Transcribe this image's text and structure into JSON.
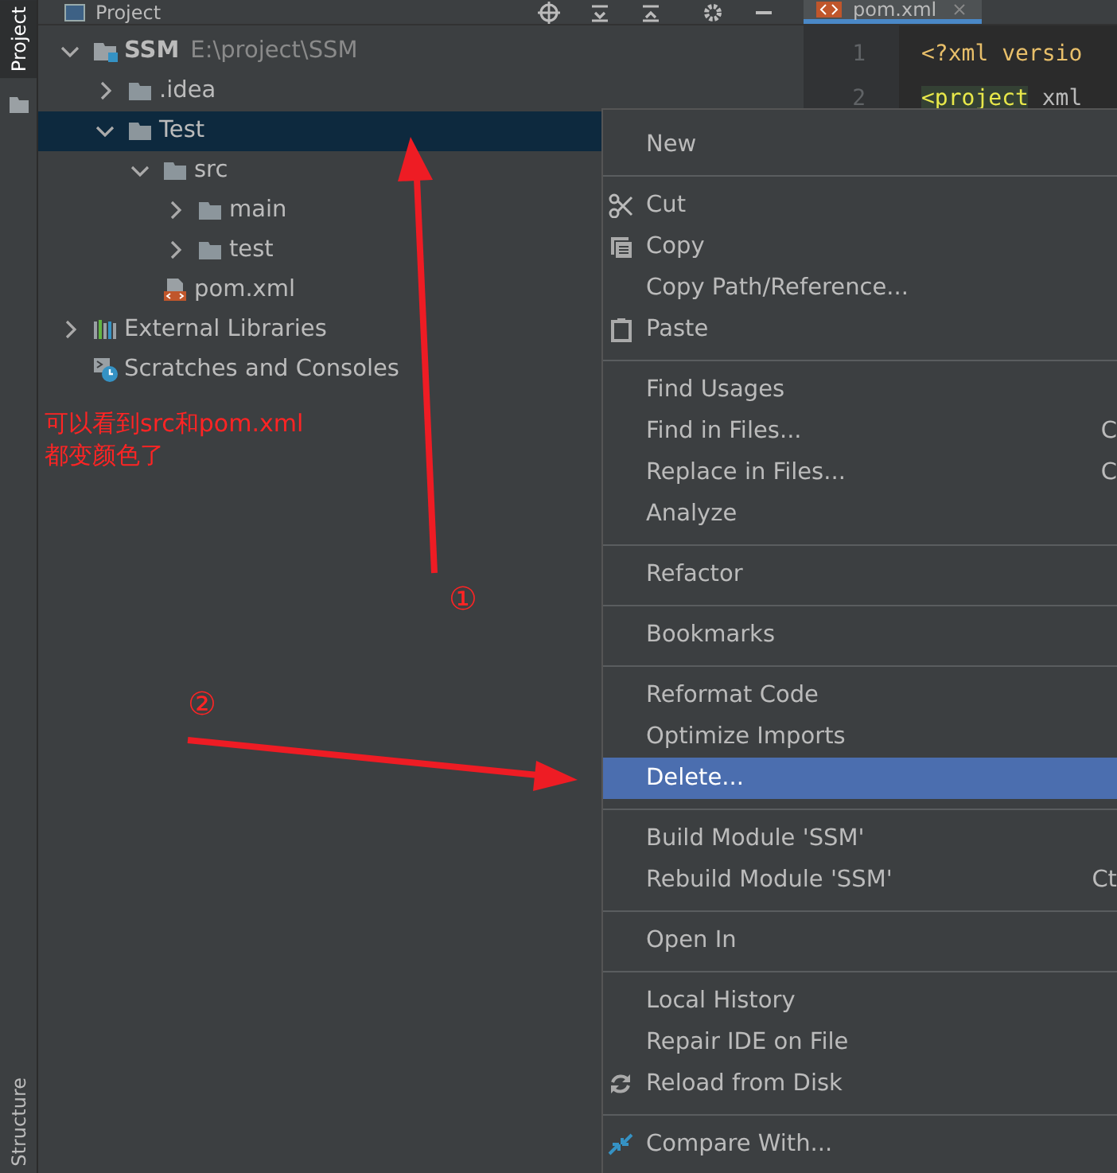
{
  "side_strip": {
    "top_tabs": [
      {
        "label": "Project",
        "selected": true
      }
    ],
    "bottom_tabs": [
      {
        "label": "Structure",
        "selected": false
      }
    ]
  },
  "project_panel": {
    "title": "Project"
  },
  "tree": [
    {
      "label": "SSM",
      "path": "E:\\project\\SSM",
      "kind": "module",
      "expanded": true,
      "selected": false,
      "children": [
        {
          "label": ".idea",
          "kind": "folder",
          "expanded": false,
          "selected": false
        },
        {
          "label": "Test",
          "kind": "folder",
          "expanded": true,
          "selected": true,
          "children": [
            {
              "label": "src",
              "kind": "folder",
              "expanded": true,
              "selected": false,
              "children": [
                {
                  "label": "main",
                  "kind": "folder",
                  "expanded": false,
                  "selected": false
                },
                {
                  "label": "test",
                  "kind": "folder",
                  "expanded": false,
                  "selected": false
                }
              ]
            },
            {
              "label": "pom.xml",
              "kind": "xml-file",
              "selected": false
            }
          ]
        }
      ]
    },
    {
      "label": "External Libraries",
      "kind": "libraries",
      "expanded": false,
      "selected": false
    },
    {
      "label": "Scratches and Consoles",
      "kind": "scratches",
      "selected": false
    }
  ],
  "editor": {
    "tab": {
      "label": "pom.xml",
      "selected": true
    },
    "lines": [
      {
        "number": "1",
        "tokens": [
          {
            "text": "<?xml versio",
            "kind": "tag"
          }
        ]
      },
      {
        "number": "2",
        "tokens": [
          {
            "text": "<project",
            "kind": "matched-tag"
          },
          {
            "text": " xml",
            "kind": "attr"
          }
        ]
      }
    ]
  },
  "context_menu": {
    "groups": [
      [
        {
          "label": "New",
          "kind": "plain",
          "selected": false
        }
      ],
      [
        {
          "label": "Cut",
          "kind": "cut",
          "selected": false
        },
        {
          "label": "Copy",
          "kind": "copy",
          "selected": false
        },
        {
          "label": "Copy Path/Reference...",
          "kind": "plain",
          "selected": false
        },
        {
          "label": "Paste",
          "kind": "paste",
          "selected": false
        }
      ],
      [
        {
          "label": "Find Usages",
          "kind": "plain",
          "selected": false
        },
        {
          "label": "Find in Files...",
          "kind": "plain",
          "shortcut": "C",
          "selected": false
        },
        {
          "label": "Replace in Files...",
          "kind": "plain",
          "shortcut": "C",
          "selected": false
        },
        {
          "label": "Analyze",
          "kind": "plain",
          "selected": false
        }
      ],
      [
        {
          "label": "Refactor",
          "kind": "plain",
          "selected": false
        }
      ],
      [
        {
          "label": "Bookmarks",
          "kind": "plain",
          "selected": false
        }
      ],
      [
        {
          "label": "Reformat Code",
          "kind": "plain",
          "selected": false
        },
        {
          "label": "Optimize Imports",
          "kind": "plain",
          "selected": false
        },
        {
          "label": "Delete...",
          "kind": "plain",
          "selected": true
        }
      ],
      [
        {
          "label": "Build Module 'SSM'",
          "kind": "plain",
          "selected": false
        },
        {
          "label": "Rebuild Module 'SSM'",
          "kind": "plain",
          "shortcut": "Ct",
          "selected": false
        }
      ],
      [
        {
          "label": "Open In",
          "kind": "plain",
          "selected": false
        }
      ],
      [
        {
          "label": "Local History",
          "kind": "plain",
          "selected": false
        },
        {
          "label": "Repair IDE on File",
          "kind": "plain",
          "selected": false
        },
        {
          "label": "Reload from Disk",
          "kind": "reload",
          "selected": false
        }
      ],
      [
        {
          "label": "Compare With...",
          "kind": "compare",
          "selected": false
        }
      ]
    ]
  },
  "annotations": {
    "note_lines": [
      "可以看到src和pom.xml",
      "都变颜色了"
    ],
    "markers": [
      {
        "text": "①"
      },
      {
        "text": "②"
      }
    ]
  }
}
